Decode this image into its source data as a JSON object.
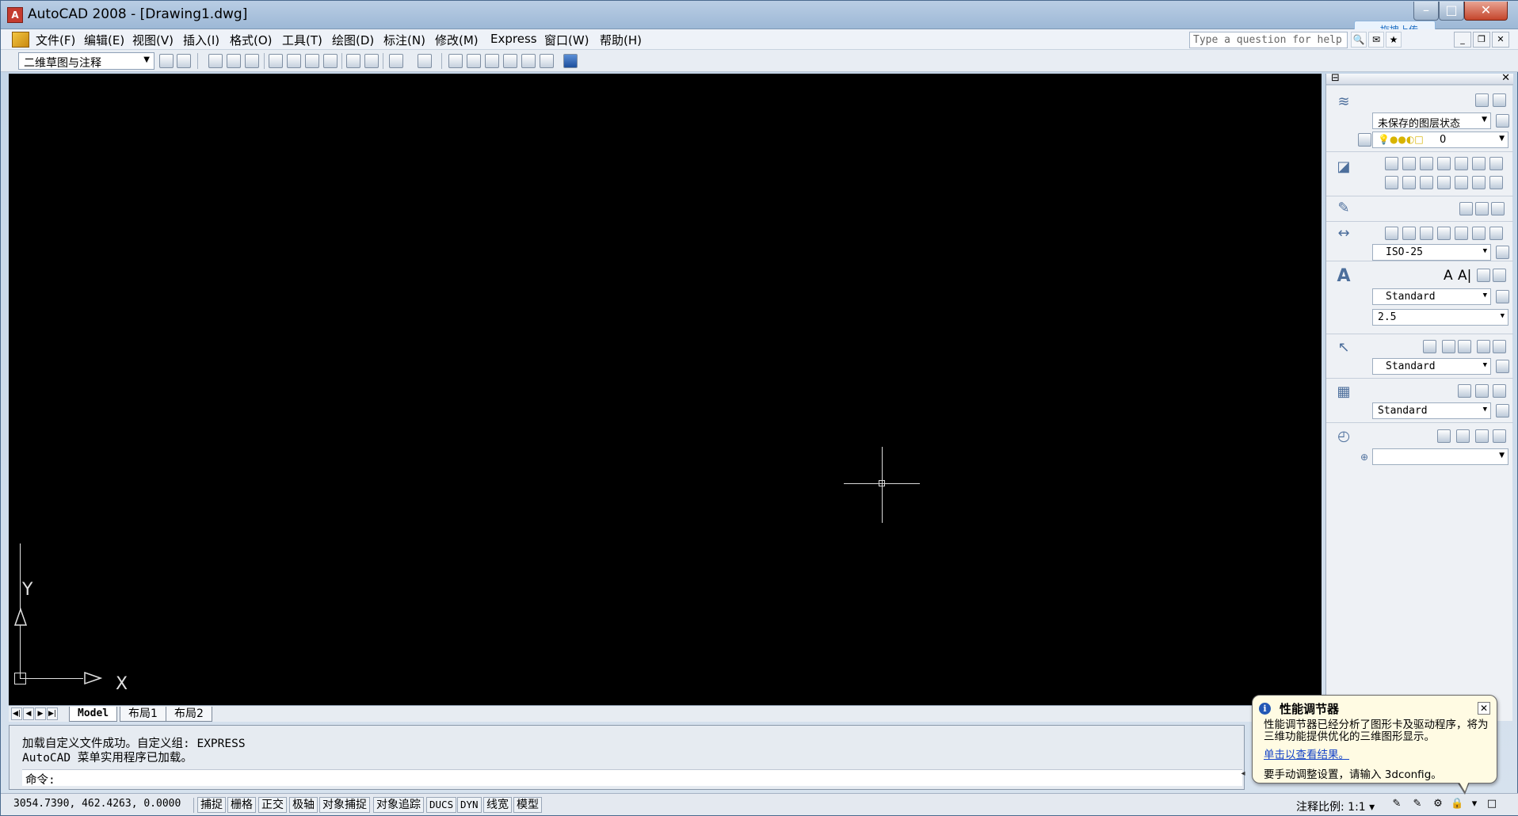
{
  "window": {
    "title": "AutoCAD 2008 - [Drawing1.dwg]",
    "min": "–",
    "max": "□",
    "close": "✕",
    "app_icon": "A"
  },
  "upload": {
    "label": "拖拽上传",
    "icon": "cloud-upload-icon"
  },
  "menu": {
    "items": [
      "文件(F)",
      "编辑(E)",
      "视图(V)",
      "插入(I)",
      "格式(O)",
      "工具(T)",
      "绘图(D)",
      "标注(N)",
      "修改(M)",
      "Express",
      "窗口(W)",
      "帮助(H)"
    ],
    "help_placeholder": "Type a question for help"
  },
  "toolbar": {
    "workspace": "二维草图与注释"
  },
  "canvas": {
    "ucs_x": "X",
    "ucs_y": "Y",
    "background": "#000000"
  },
  "layout_tabs": [
    "Model",
    "布局1",
    "布局2"
  ],
  "palette": {
    "layer_state": "未保存的图层状态",
    "layer_current": "0",
    "dim_style": "ISO-25",
    "text_style": "Standard",
    "text_height": "2.5",
    "mleader_style": "Standard",
    "table_style": "Standard",
    "text_icons": [
      "A",
      "A|"
    ]
  },
  "command": {
    "history": [
      "加载自定义文件成功。自定义组: EXPRESS",
      "AutoCAD 菜单实用程序已加载。"
    ],
    "prompt": "命令:"
  },
  "status": {
    "coords": "3054.7390, 462.4263, 0.0000",
    "buttons": [
      "捕捉",
      "栅格",
      "正交",
      "极轴",
      "对象捕捉",
      "对象追踪",
      "DUCS",
      "DYN",
      "线宽",
      "模型"
    ],
    "annotation_scale": "注释比例: 1:1 ▾"
  },
  "balloon": {
    "title": "性能调节器",
    "body": "性能调节器已经分析了图形卡及驱动程序，将为三维功能提供优化的三维图形显示。",
    "link": "单击以查看结果。",
    "footer": "要手动调整设置，请输入 3dconfig。"
  }
}
